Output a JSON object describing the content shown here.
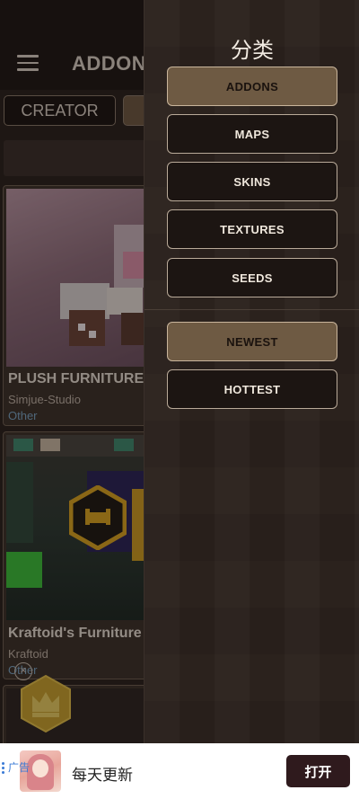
{
  "header": {
    "title": "ADDON"
  },
  "filters": {
    "creator_label": "CREATOR"
  },
  "cards": [
    {
      "title": "PLUSH FURNITURE",
      "author": "Simjue-Studio",
      "category": "Other"
    },
    {
      "title": "Kraftoid's Furniture",
      "author": "Kraftoid",
      "category": "Other"
    }
  ],
  "drawer": {
    "title": "分类",
    "categories": [
      {
        "label": "ADDONS",
        "selected": true
      },
      {
        "label": "MAPS",
        "selected": false
      },
      {
        "label": "SKINS",
        "selected": false
      },
      {
        "label": "TEXTURES",
        "selected": false
      },
      {
        "label": "SEEDS",
        "selected": false
      }
    ],
    "sort": [
      {
        "label": "NEWEST",
        "selected": true
      },
      {
        "label": "HOTTEST",
        "selected": false
      }
    ]
  },
  "ad": {
    "text": "每天更新",
    "button": "打开",
    "label": "广告"
  },
  "icons": {
    "menu": "menu-icon",
    "crown": "crown-icon",
    "close": "close-icon"
  },
  "colors": {
    "accent": "#6e5a43",
    "drawer_bg": "#2b221d",
    "button_bg": "#1c1512",
    "ad_button": "#2f1a1d",
    "link": "#7aa3c2"
  }
}
